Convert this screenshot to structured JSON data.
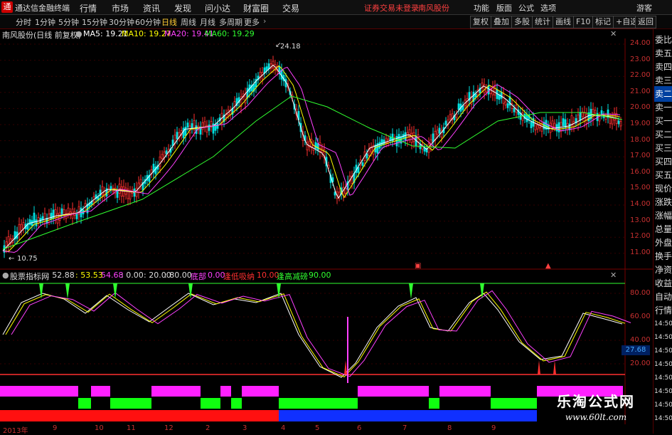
{
  "menubar": {
    "app_name": "通达信金融终端",
    "items": [
      "行情",
      "市场",
      "资讯",
      "发现",
      "问小达",
      "财富圈",
      "交易"
    ],
    "warn": "证券交易未登录",
    "stock": "南风股份",
    "right_items": [
      "功能",
      "版面",
      "公式",
      "选项"
    ],
    "guest": "游客"
  },
  "toolbar": {
    "periods": [
      "分时",
      "1分钟",
      "5分钟",
      "15分钟",
      "30分钟",
      "60分钟",
      "日线",
      "周线",
      "月线",
      "多周期",
      "更多"
    ],
    "active": "日线",
    "right_buttons": [
      "复权",
      "叠加",
      "多股",
      "统计",
      "画线",
      "F10",
      "标记",
      "+自选",
      "返回"
    ]
  },
  "price_info": {
    "title": "南风股份(日线 前复权)",
    "ma5": "MA5: 19.21",
    "ma10": "MA10: 19.27",
    "ma20": "MA20: 19.41",
    "ma60": "MA60: 19.29",
    "colors": {
      "ma5": "#ffffff",
      "ma10": "#ffff00",
      "ma20": "#ff40ff",
      "ma60": "#30ff30"
    }
  },
  "price_axis": [
    "24.00",
    "23.00",
    "22.00",
    "21.00",
    "20.00",
    "19.00",
    "18.00",
    "17.00",
    "16.00",
    "15.00",
    "14.00",
    "13.00",
    "12.00",
    "11.00"
  ],
  "price_labels": {
    "high": "24.18",
    "low": "10.75"
  },
  "indicator_info": {
    "name": "股票指标网",
    "v1": ": 52.88",
    "v2": ": 53.53",
    "v3": "54.68",
    "v4": ": 0.00",
    "v5": ": 20.00",
    "v6": ": 80.00",
    "label_bottom": "底部",
    "v_bottom": "0.00",
    "label_wait": "逢低吸纳",
    "v_wait": "10.00",
    "label_high": "逢高减磅",
    "v_high": "90.00"
  },
  "indicator_axis": [
    "80.00",
    "60.00",
    "40.00",
    "20.00"
  ],
  "indicator_current": "27.68",
  "right_panel": [
    "委比",
    "卖五",
    "卖四",
    "卖三",
    "卖二",
    "卖一",
    "买一",
    "买二",
    "买三",
    "买四",
    "买五",
    "现价",
    "涨跌",
    "涨幅",
    "总量",
    "外盘",
    "换手",
    "净资",
    "收益",
    "自动",
    "行情",
    "14:50",
    "14:50",
    "14:50",
    "14:50",
    "14:50",
    "14:50",
    "14:50",
    "14:50"
  ],
  "dates": [
    "2013年",
    "9",
    "10",
    "11",
    "12",
    "2",
    "3",
    "4",
    "5",
    "6",
    "7",
    "8",
    "9"
  ],
  "watermark": {
    "title": "乐淘公式网",
    "url": "www.60lt.com"
  }
}
